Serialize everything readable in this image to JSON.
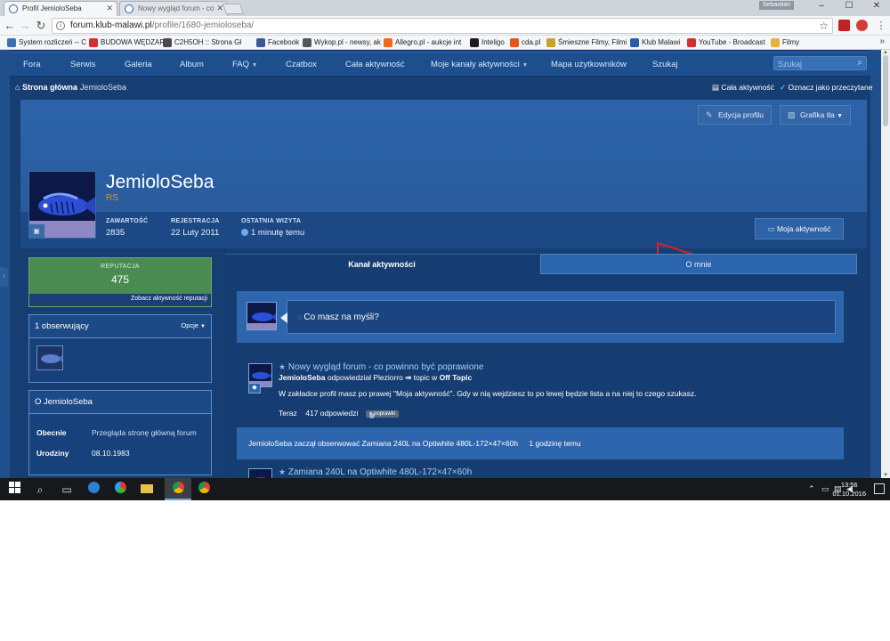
{
  "browser": {
    "tabs": [
      {
        "title": "Profil JemioloSeba",
        "active": true
      },
      {
        "title": "Nowy wygląd forum - co",
        "active": false
      }
    ],
    "user_badge": "Sebastian",
    "window_controls": [
      "–",
      "☐",
      "✕"
    ],
    "url_host": "forum.klub-malawi.pl",
    "url_path": "/profile/1680-jemioloseba/",
    "bookmarks": [
      {
        "label": "System rozliczeń -- C",
        "color": "#3a6fb8"
      },
      {
        "label": "BUDOWA WĘDZARNI",
        "color": "#d0312d"
      },
      {
        "label": "C2H5OH :: Strona Gł",
        "color": "#4a4a4a"
      },
      {
        "label": "Facebook",
        "color": "#3b5998"
      },
      {
        "label": "Wykop.pl - newsy, ak",
        "color": "#555555"
      },
      {
        "label": "Allegro.pl - aukcje int",
        "color": "#f06a1a"
      },
      {
        "label": "Inteligo",
        "color": "#1c1c1c"
      },
      {
        "label": "cda.pl",
        "color": "#e8541b"
      },
      {
        "label": "Śmieszne Filmy, Filmi",
        "color": "#c9a227"
      },
      {
        "label": "Klub Malawi",
        "color": "#2d5da8"
      },
      {
        "label": "YouTube - Broadcast",
        "color": "#d0312d"
      },
      {
        "label": "Filmy",
        "color": "#e3b341"
      }
    ],
    "bookmarks_more": "»"
  },
  "nav": {
    "items": [
      {
        "label": "Fora"
      },
      {
        "label": "Serwis"
      },
      {
        "label": "Galeria"
      },
      {
        "label": "Album"
      },
      {
        "label": "FAQ",
        "dropdown": true
      },
      {
        "label": "Czatbox"
      },
      {
        "label": "Cała aktywność"
      },
      {
        "label": "Moje kanały aktywności",
        "dropdown": true
      },
      {
        "label": "Mapa użytkowników"
      },
      {
        "label": "Szukaj"
      }
    ],
    "search_placeholder": "Szukaj"
  },
  "breadcrumb": {
    "home": "Strona główna",
    "current": "JemioloSeba",
    "all_activity": "Cała aktywność",
    "mark_read": "Oznacz jako przeczytane"
  },
  "profile": {
    "cover_buttons": {
      "edit": "Edycja profilu",
      "cover_photo": "Grafika tła"
    },
    "username": "JemioloSeba",
    "user_title": "RS",
    "stats": [
      {
        "label": "ZAWARTOŚĆ",
        "value": "2835"
      },
      {
        "label": "REJESTRACJA",
        "value": "22 Luty 2011"
      },
      {
        "label": "OSTATNIA WIZYTA",
        "value": "1 minutę temu"
      }
    ],
    "my_activity_button": "Moja aktywność"
  },
  "sidebar": {
    "reputation_label": "REPUTACJA",
    "reputation_value": "475",
    "reputation_link": "Zobacz aktywność reputacji",
    "followers_title": "1 obserwujący",
    "followers_options": "Opcje",
    "about_title": "O JemioloSeba",
    "about_rows": [
      {
        "key": "Obecnie",
        "value": "Przegląda stronę główną forum"
      },
      {
        "key": "Urodziny",
        "value": "08.10.1983"
      }
    ]
  },
  "content": {
    "tabs": [
      {
        "label": "Kanał aktywności",
        "active": true
      },
      {
        "label": "O mnie",
        "active": false
      }
    ],
    "status_placeholder": "Co masz na myśli?",
    "feed": [
      {
        "title": "Nowy wygląd forum - co powinno być poprawione",
        "user": "JemioloSeba",
        "action": "odpowiedział Pleziorro",
        "arrow": "⇒",
        "topic_prefix": "topic w",
        "forum": "Off Topic",
        "body": "W zakładce profil masz po prawej \"Moja aktywność\". Gdy w nią wejdziesz to po lewej będzie lista a na niej to czego szukasz.",
        "time": "Teraz",
        "replies": "417 odpowiedzi",
        "tag": "poprawki"
      }
    ],
    "follow_event": {
      "text": "JemioloSeba zaczął obserwować Zamiana 240L na Optiwhite 480L-172×47×60h",
      "time": "1 godzinę temu"
    },
    "feed2_title": "Zamiana 240L na Optiwhite 480L-172×47×60h"
  },
  "taskbar": {
    "time": "13:56",
    "date": "01.10.2016"
  },
  "colors": {
    "page_bg": "#163e73",
    "nav_bg": "#1d4f8f",
    "accent": "#2e66ad",
    "reputation_green": "#4a8b52",
    "annotation_arrow": "#e02020"
  }
}
